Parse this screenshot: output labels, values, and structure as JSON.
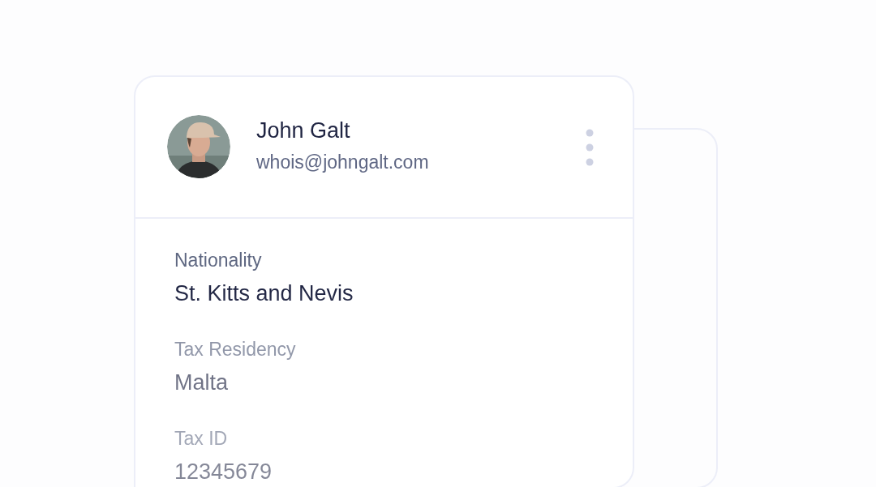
{
  "profile": {
    "name": "John Galt",
    "email": "whois@johngalt.com"
  },
  "fields": [
    {
      "label": "Nationality",
      "value": "St. Kitts and Nevis"
    },
    {
      "label": "Tax Residency",
      "value": "Malta"
    },
    {
      "label": "Tax ID",
      "value": "12345679"
    }
  ]
}
